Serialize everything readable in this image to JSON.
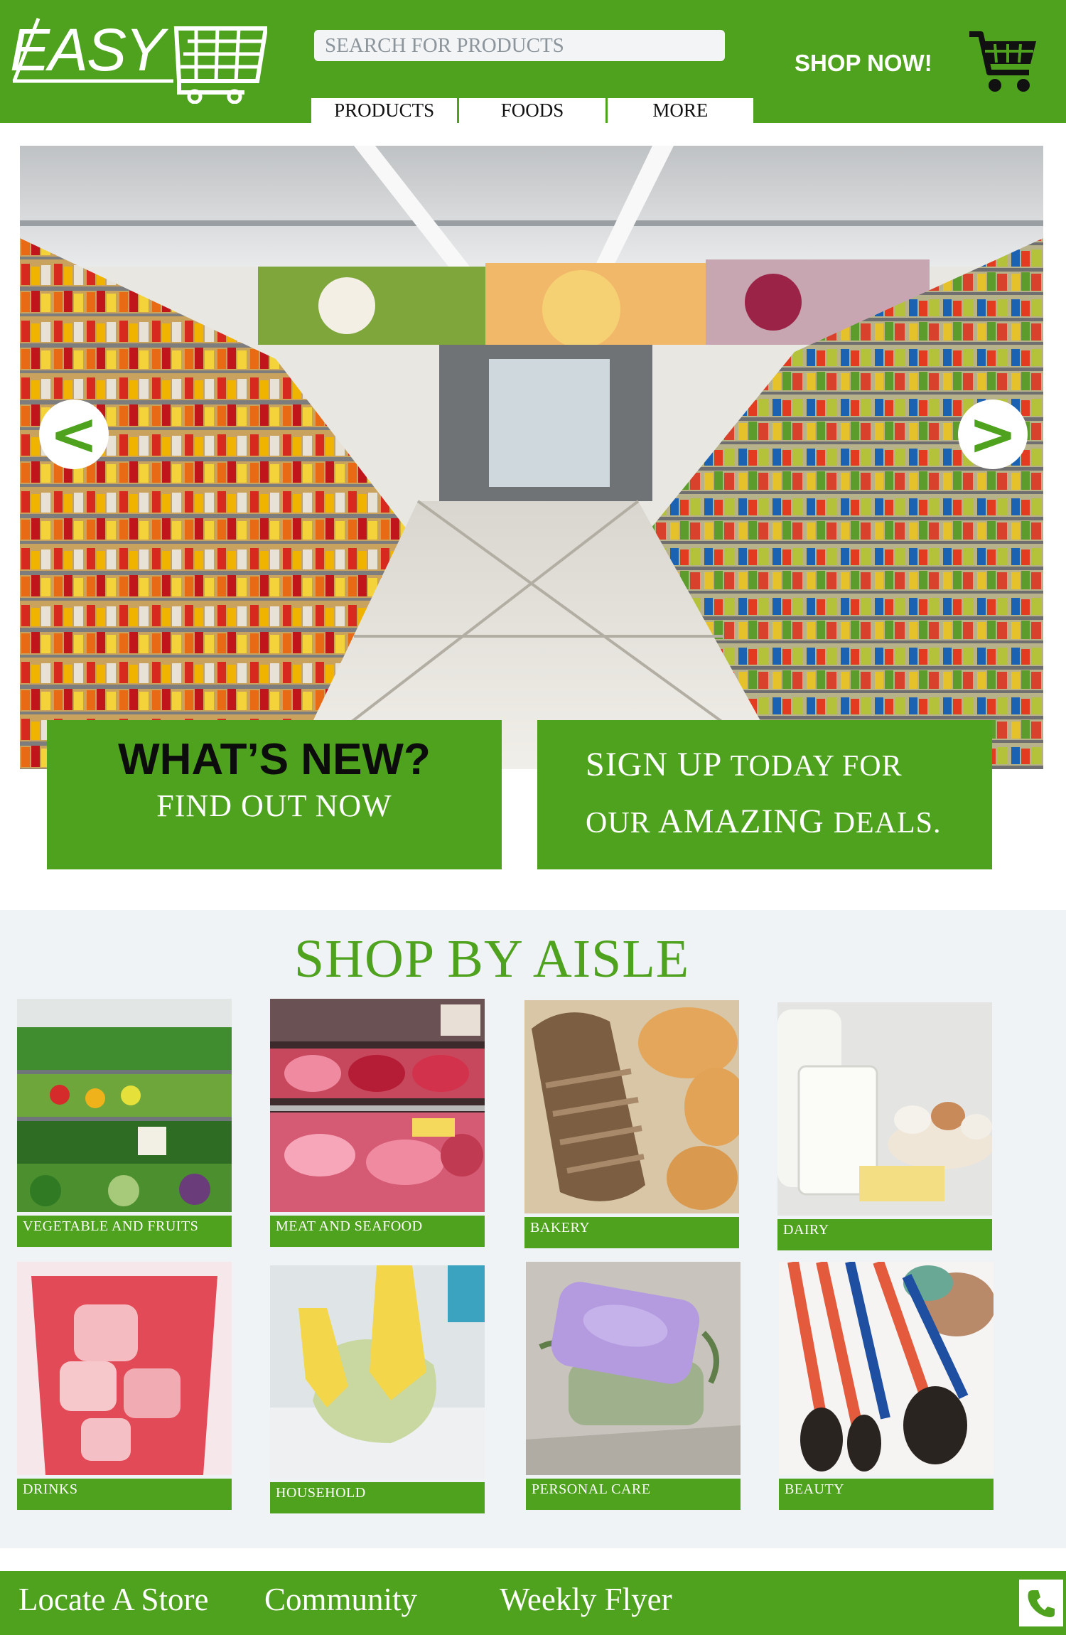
{
  "header": {
    "logo_text": "EASY",
    "search_placeholder": "SEARCH FOR PRODUCTS",
    "nav": [
      "PRODUCTS",
      "FOODS",
      "MORE"
    ],
    "shop_now": "SHOP NOW!",
    "cart_icon": "shopping-cart-icon"
  },
  "hero": {
    "image": "supermarket-aisle-photo",
    "prev_arrow": "<",
    "next_arrow": ">",
    "promo_new": {
      "headline": "WHAT’S NEW?",
      "sub": "FIND OUT NOW"
    },
    "promo_signup": {
      "line1_big": "SIGN UP",
      "line1_small": "TODAY FOR",
      "line2_small_a": "OUR",
      "line2_big": "AMAZING",
      "line2_small_b": "DEALS."
    }
  },
  "aisles": {
    "title": "SHOP BY AISLE",
    "items": [
      {
        "label": "VEGETABLE AND FRUITS"
      },
      {
        "label": "MEAT AND SEAFOOD"
      },
      {
        "label": "BAKERY"
      },
      {
        "label": "DAIRY"
      },
      {
        "label": "DRINKS"
      },
      {
        "label": "HOUSEHOLD"
      },
      {
        "label": "PERSONAL CARE"
      },
      {
        "label": "BEAUTY"
      }
    ]
  },
  "footer": {
    "links": [
      "Locate A Store",
      "Community",
      "Weekly Flyer"
    ],
    "phone_icon": "phone-icon"
  },
  "colors": {
    "brand_green": "#4fa21d",
    "section_bg": "#eff3f6"
  }
}
